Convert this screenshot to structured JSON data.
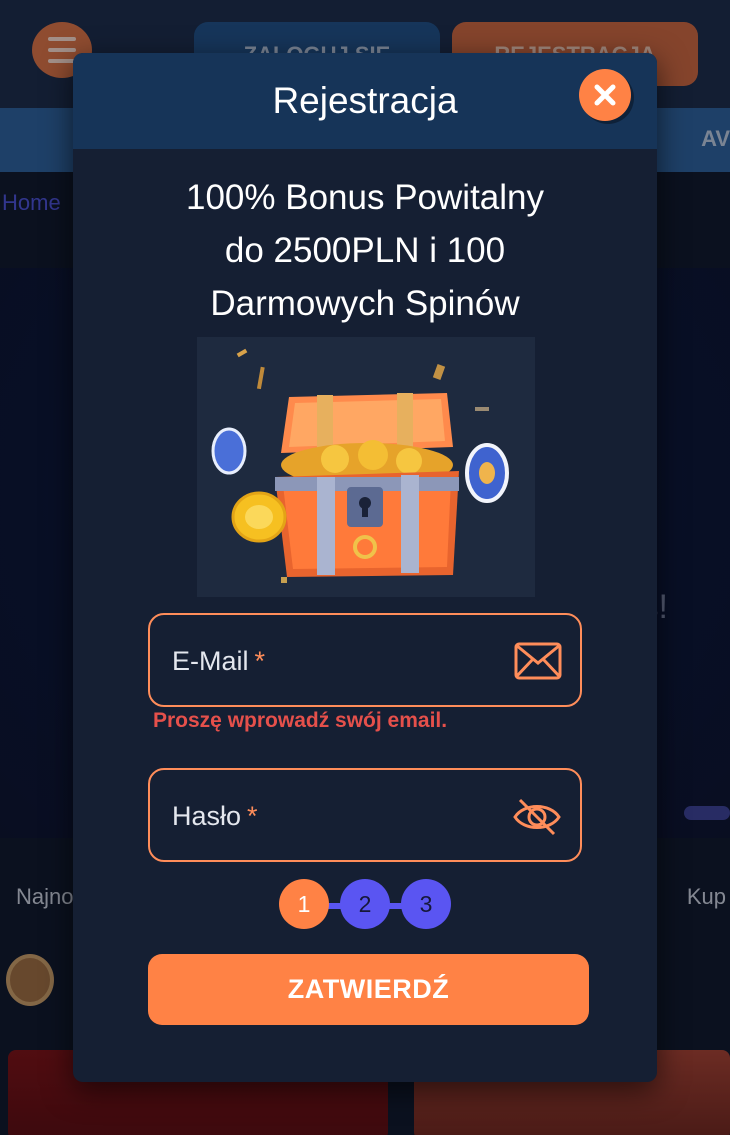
{
  "background": {
    "login_label": "ZALOGUJ SIĘ",
    "register_label": "REJESTRACJA",
    "nav_right_text": "AV",
    "breadcrumb": "Home",
    "hero_text": "s!",
    "category_left": "Najno",
    "category_right": "Kup"
  },
  "modal": {
    "title": "Rejestracja",
    "promo_line1": "100% Bonus Powitalny",
    "promo_line2": "do 2500PLN i 100",
    "promo_line3": "Darmowych Spinów",
    "email_label": "E-Mail",
    "email_required": "*",
    "email_error": "Proszę wprowadź swój email.",
    "password_label": "Hasło",
    "password_required": "*",
    "steps": [
      "1",
      "2",
      "3"
    ],
    "submit_label": "ZATWIERDŹ"
  },
  "colors": {
    "accent": "#ff8245",
    "error": "#e5504b",
    "step_inactive": "#5a55f2",
    "modal_bg": "#151f33",
    "modal_header": "#163458"
  },
  "icons": {
    "menu": "hamburger-icon",
    "close": "close-icon",
    "email": "envelope-icon",
    "password": "eye-slash-icon",
    "clock": "clock-icon"
  }
}
